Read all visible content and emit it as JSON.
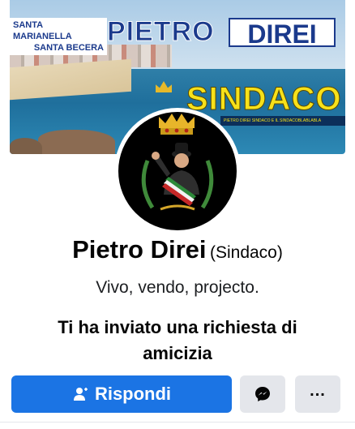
{
  "cover": {
    "santa_line1": "SANTA MARIANELLA",
    "santa_line2": "SANTA BECERA",
    "title_pietro": "PIETRO",
    "title_direi": "DIREI",
    "sindaco": "SINDACO",
    "slogan": "PIETRO DIREI SINDACO E IL SINDACOBLABLABLA"
  },
  "profile": {
    "name": "Pietro Direi",
    "alternate_name": "(Sindaco)",
    "bio": "Vivo, vendo, projecto.",
    "request_line1": "Ti ha inviato una richiesta di",
    "request_line2": "amicizia"
  },
  "actions": {
    "respond_label": "Rispondi",
    "respond_icon": "person-icon",
    "messenger_icon": "messenger-icon",
    "more_label": "..."
  },
  "colors": {
    "primary": "#1b74e4",
    "secondary": "#e4e6eb",
    "cover_title": "#1b3a8c",
    "sindaco": "#f7e11a"
  }
}
